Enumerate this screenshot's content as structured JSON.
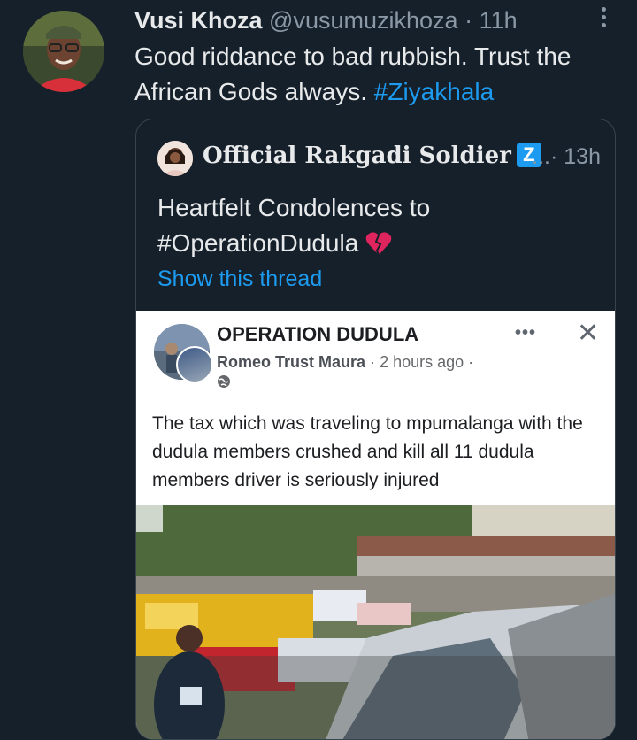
{
  "tweet": {
    "author_name": "Vusi Khoza",
    "author_handle": "@vusumuzikhoza",
    "separator": "·",
    "time": "11h",
    "text_part1": "Good riddance to bad rubbish. Trust the African Gods always.",
    "hashtag": "#Ziyakhala",
    "avatar_icon": "profile-photo",
    "more_icon": "more-vertical-icon"
  },
  "quote": {
    "author_name": "Official Rakgadi Soldier",
    "badge": "Z",
    "meta_dots": "...",
    "separator": "·",
    "time": "13h",
    "text_line1": "Heartfelt Condolences to",
    "hashtag": "#OperationDudula",
    "emoji_icon": "broken-heart-icon",
    "show_thread": "Show this thread"
  },
  "facebook_post": {
    "page_name": "OPERATION DUDULA",
    "author": "Romeo Trust Maura",
    "separator": "·",
    "time": "2 hours ago",
    "trailing_dot": "·",
    "dots": "•••",
    "close": "✕",
    "globe_icon": "globe-icon",
    "text": "The tax which was traveling to mpumalanga with the dudula members crushed and kill all 11 dudula members driver is seriously injured",
    "photo_icon": "crash-scene-photo"
  },
  "colors": {
    "background": "#15202b",
    "text": "#e7e9ea",
    "secondary": "#8b98a5",
    "accent": "#1d9bf0"
  }
}
